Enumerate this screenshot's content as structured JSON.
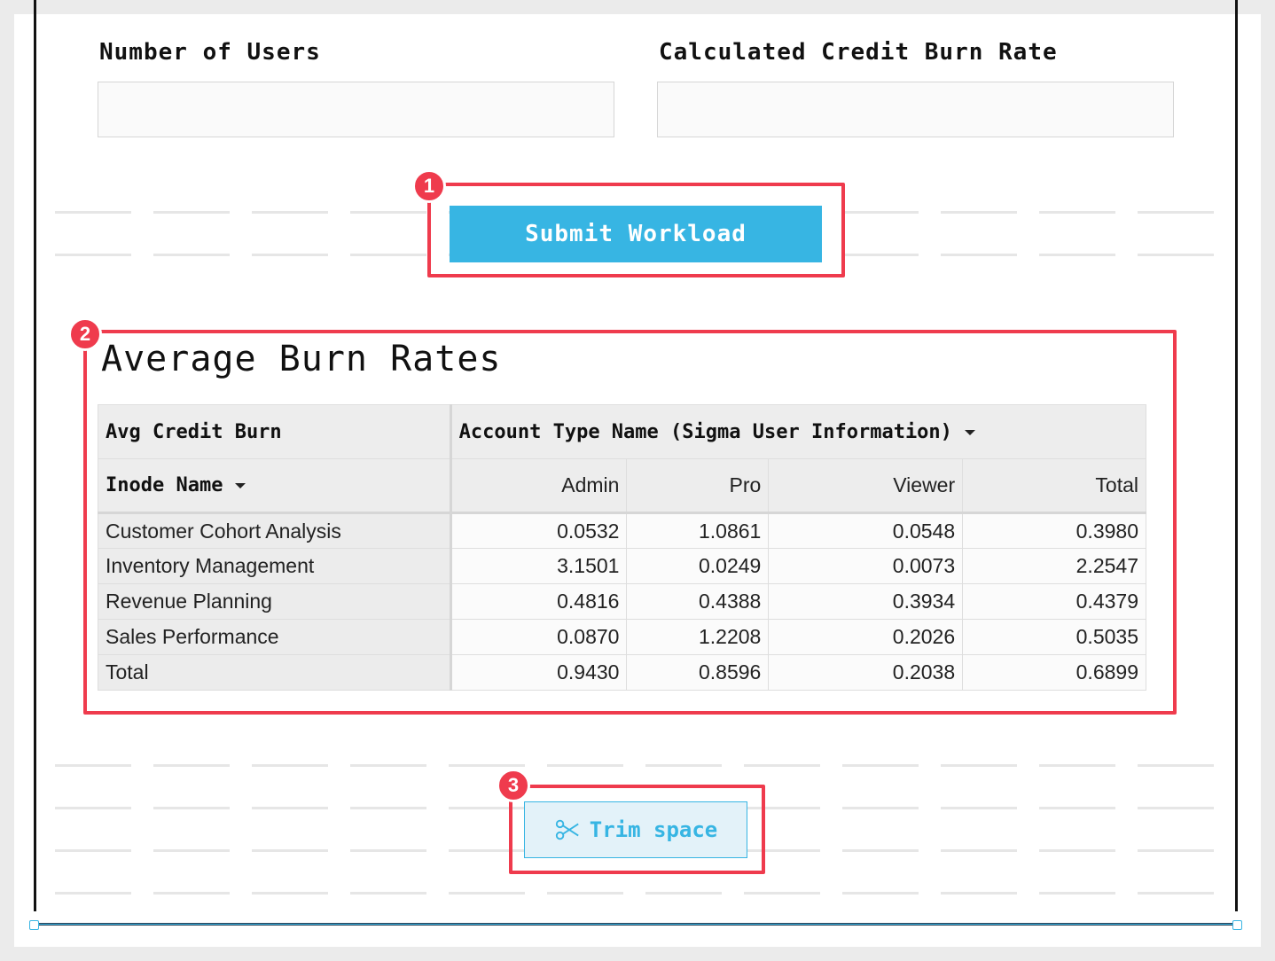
{
  "form": {
    "users_label": "Number of Users",
    "users_value": "",
    "burn_rate_label": "Calculated Credit Burn Rate",
    "burn_rate_value": "",
    "submit_label": "Submit Workload"
  },
  "annotations": [
    "1",
    "2",
    "3"
  ],
  "section": {
    "title": "Average Burn Rates"
  },
  "pivot": {
    "value_header": "Avg Credit Burn",
    "column_group_header": "Account Type Name (Sigma User Information)",
    "row_header": "Inode Name",
    "columns": [
      "Admin",
      "Pro",
      "Viewer",
      "Total"
    ],
    "rows": [
      {
        "name": "Customer Cohort Analysis",
        "values": [
          "0.0532",
          "1.0861",
          "0.0548",
          "0.3980"
        ]
      },
      {
        "name": "Inventory Management",
        "values": [
          "3.1501",
          "0.0249",
          "0.0073",
          "2.2547"
        ]
      },
      {
        "name": "Revenue Planning",
        "values": [
          "0.4816",
          "0.4388",
          "0.3934",
          "0.4379"
        ]
      },
      {
        "name": "Sales Performance",
        "values": [
          "0.0870",
          "1.2208",
          "0.2026",
          "0.5035"
        ]
      },
      {
        "name": "Total",
        "values": [
          "0.9430",
          "0.8596",
          "0.2038",
          "0.6899"
        ]
      }
    ]
  },
  "trim": {
    "label": "Trim space",
    "icon": "scissors-icon"
  },
  "colors": {
    "accent": "#37b5e3",
    "annotation": "#ef3b4d"
  }
}
